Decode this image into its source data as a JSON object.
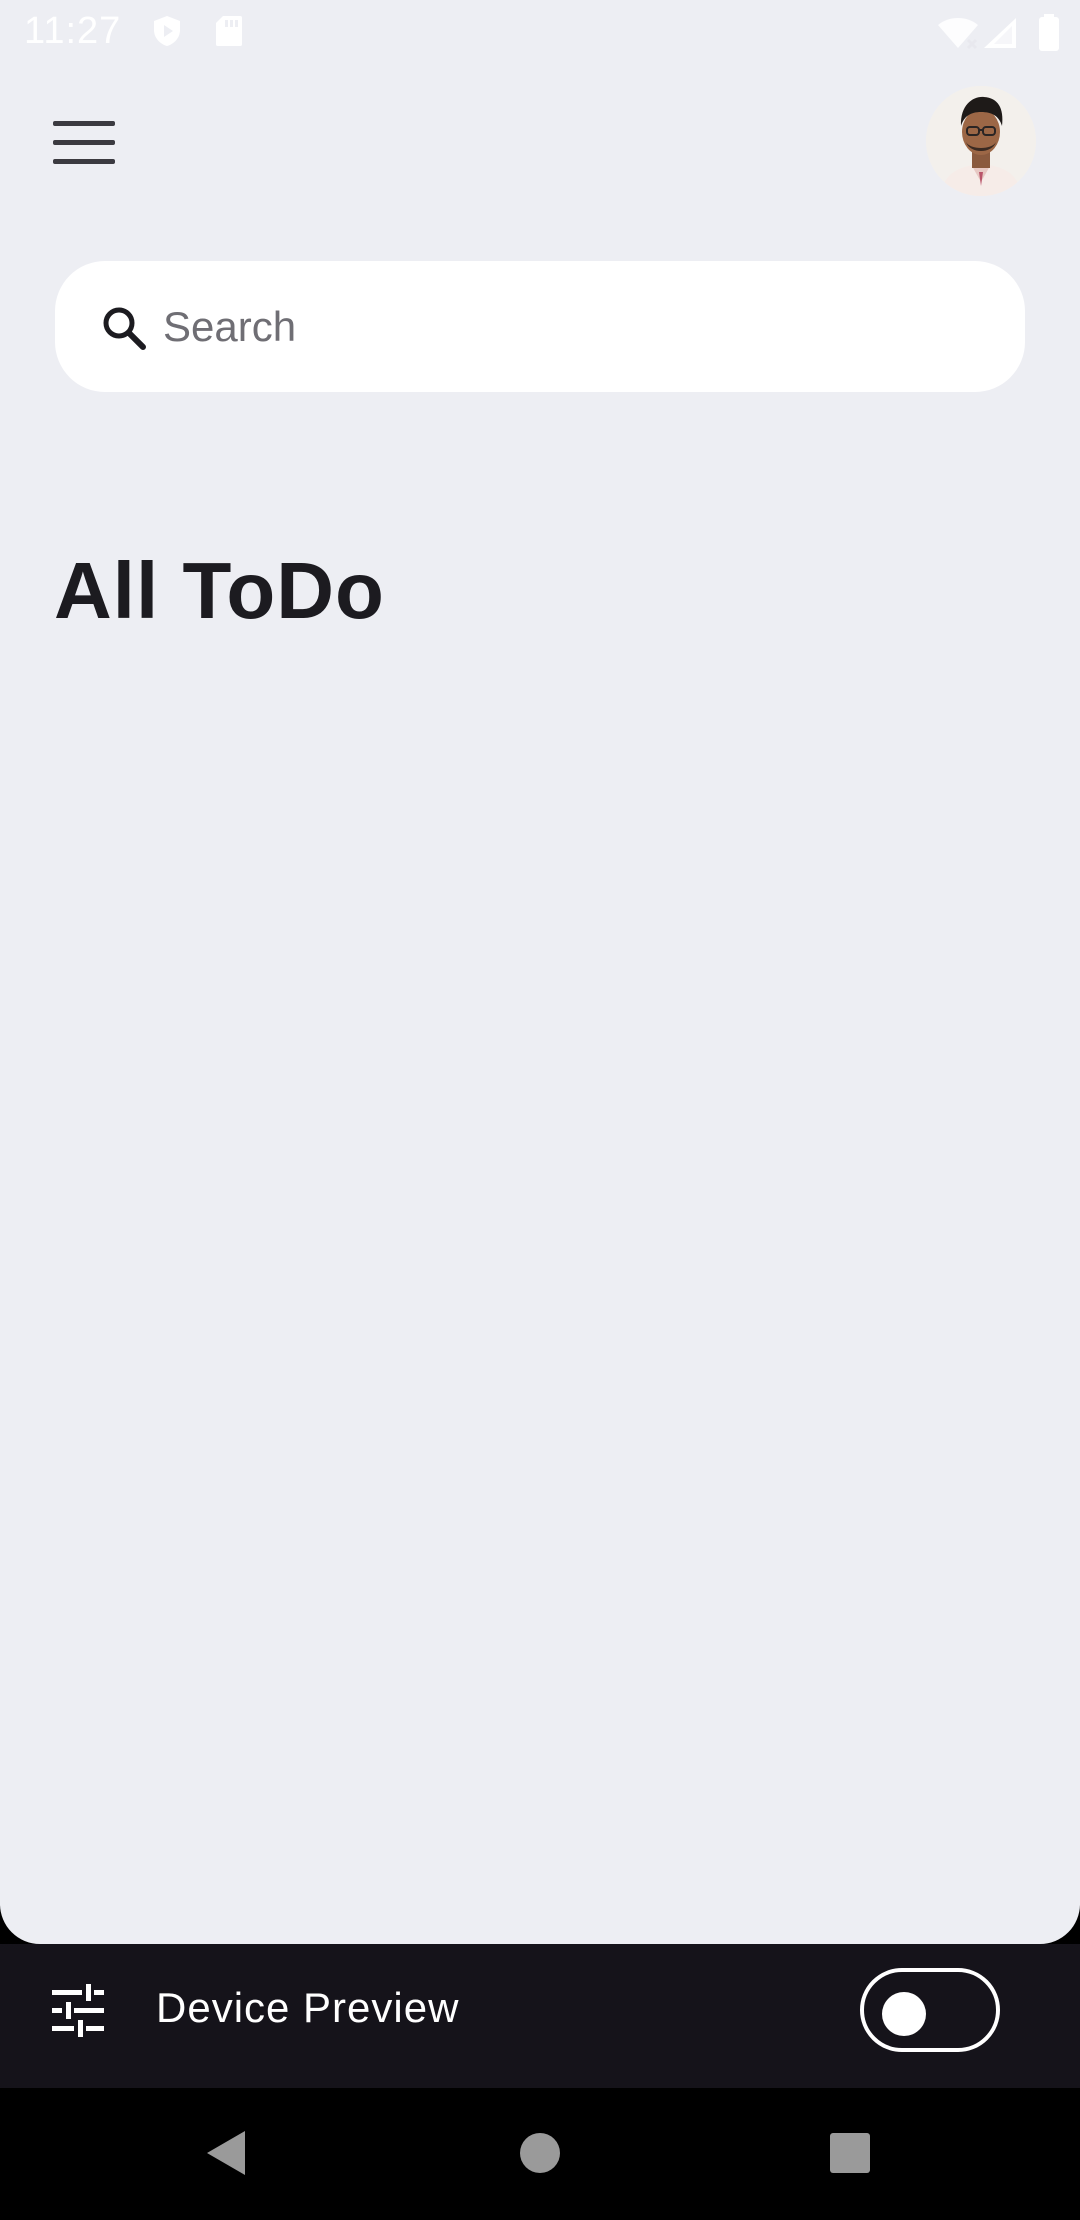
{
  "status_bar": {
    "time": "11:27"
  },
  "header": {
    "menu_icon": "hamburger-menu-icon",
    "avatar_icon": "profile-photo"
  },
  "search": {
    "placeholder": "Search",
    "value": "",
    "icon": "search-icon"
  },
  "main": {
    "title": "All ToDo"
  },
  "device_preview": {
    "label": "Device Preview",
    "toggle_on": false,
    "icon": "tune-sliders-icon"
  },
  "colors": {
    "app_background": "#EDEEF3",
    "surface": "#FFFFFF",
    "text_primary": "#1C1B20",
    "text_hint": "#6F6E74",
    "device_bar": "#15131A",
    "nav_bar": "#000000"
  }
}
